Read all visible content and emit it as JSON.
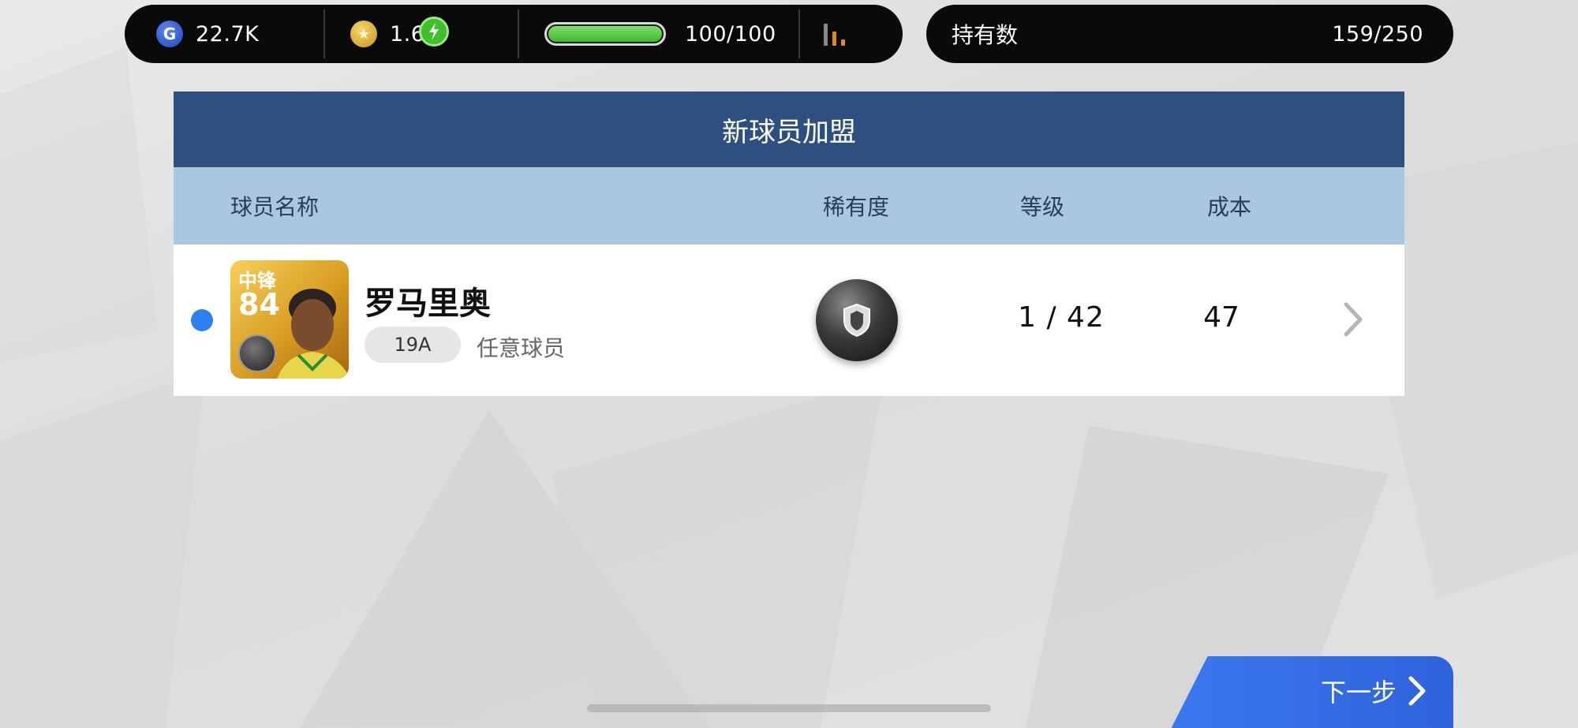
{
  "currency": {
    "gp_icon": "G",
    "gp_value": "22.7K",
    "coins_icon": "★",
    "coins_value": "1.6K",
    "stamina_value": "100/100",
    "stamina_fraction": 1.0
  },
  "ownership": {
    "label": "持有数",
    "value": "159/250"
  },
  "panel": {
    "title": "新球员加盟",
    "columns": {
      "name": "球员名称",
      "rarity": "稀有度",
      "level": "等级",
      "cost": "成本"
    }
  },
  "player": {
    "position": "中锋",
    "rating": "84",
    "name": "罗马里奥",
    "version": "19A",
    "type": "任意球员",
    "level": "1 / 42",
    "cost": "47",
    "rarity_icon": "black-ball-icon"
  },
  "next_button": {
    "label": "下一步"
  },
  "colors": {
    "title_bar": "#2d5080",
    "header_bar": "#a9c8e0",
    "accent_blue": "#2f7ff0",
    "stamina_green": "#3db82b"
  }
}
